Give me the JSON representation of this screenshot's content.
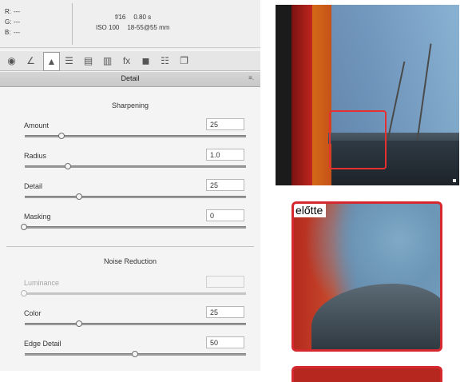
{
  "info": {
    "rgb": [
      {
        "label": "R:",
        "value": "---"
      },
      {
        "label": "G:",
        "value": "---"
      },
      {
        "label": "B:",
        "value": "---"
      }
    ],
    "aperture": "f/16",
    "shutter": "0.80 s",
    "iso": "ISO 100",
    "lens": "18-55@55 mm"
  },
  "toolbar": {
    "tabs": [
      {
        "name": "basic",
        "icon": "aperture-icon",
        "glyph": "◉"
      },
      {
        "name": "tone-curve",
        "icon": "tone-curve-icon",
        "glyph": "∠"
      },
      {
        "name": "detail",
        "icon": "detail-icon",
        "glyph": "▲",
        "active": true
      },
      {
        "name": "hsl",
        "icon": "hsl-icon",
        "glyph": "☰"
      },
      {
        "name": "split-toning",
        "icon": "split-toning-icon",
        "glyph": "▤"
      },
      {
        "name": "lens-corrections",
        "icon": "lens-corrections-icon",
        "glyph": "▥"
      },
      {
        "name": "effects",
        "icon": "fx-icon",
        "glyph": "fx"
      },
      {
        "name": "camera-calibration",
        "icon": "camera-icon",
        "glyph": "◼"
      },
      {
        "name": "presets",
        "icon": "presets-icon",
        "glyph": "☷"
      },
      {
        "name": "snapshots",
        "icon": "snapshots-icon",
        "glyph": "❐"
      }
    ]
  },
  "panel": {
    "title": "Detail",
    "menu_glyph": "≡."
  },
  "sharpening": {
    "title": "Sharpening",
    "sliders": [
      {
        "label": "Amount",
        "value": "25",
        "pos": 0.17
      },
      {
        "label": "Radius",
        "value": "1.0",
        "pos": 0.2
      },
      {
        "label": "Detail",
        "value": "25",
        "pos": 0.25
      },
      {
        "label": "Masking",
        "value": "0",
        "pos": 0.0
      }
    ]
  },
  "noise": {
    "title": "Noise Reduction",
    "sliders": [
      {
        "label": "Luminance",
        "value": "",
        "pos": 0.0,
        "disabled": true
      },
      {
        "label": "Color",
        "value": "25",
        "pos": 0.25
      },
      {
        "label": "Edge Detail",
        "value": "50",
        "pos": 0.5
      }
    ]
  },
  "images": {
    "before_label": "előtte"
  },
  "colors": {
    "accent_red": "#d5282f",
    "panel_bg": "#f4f4f4"
  }
}
